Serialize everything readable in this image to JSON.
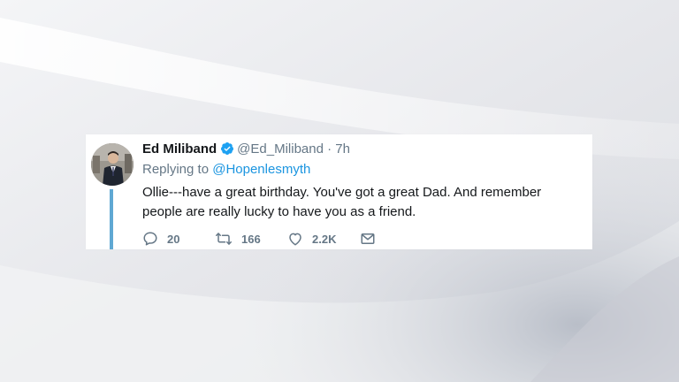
{
  "background": {
    "base_color": "#e9eaee"
  },
  "tweet": {
    "author_name": "Ed Miliband",
    "verified_icon": "verified-badge-icon",
    "handle": "@Ed_Miliband",
    "separator": "·",
    "time": "7h",
    "reply_prefix": "Replying to",
    "reply_to": "@Hopenlesmyth",
    "text": "Ollie---have a great birthday. You've got a great Dad. And remember people are really lucky to have you as a friend.",
    "replies": "20",
    "retweets": "166",
    "likes": "2.2K",
    "accent_color": "#1b95e0",
    "thread_line_color": "#5fa8d3"
  },
  "actions": {
    "reply_icon": "reply-icon",
    "retweet_icon": "retweet-icon",
    "like_icon": "heart-icon",
    "dm_icon": "envelope-icon"
  }
}
